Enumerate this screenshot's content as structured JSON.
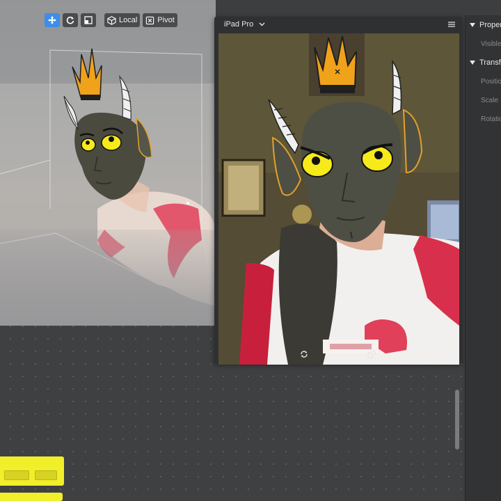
{
  "toolbar": {
    "move_tool": "move-arrows-icon",
    "rotate_tool": "rotate-icon",
    "scale_tool": "scale-icon",
    "space_label": "Local",
    "pivot_label": "Pivot"
  },
  "preview": {
    "device_label": "iPad Pro",
    "menu_icon": "hamburger-icon",
    "footer_left_icon": "flip-camera-icon",
    "footer_right_icon": "rotate-device-icon"
  },
  "inspector": {
    "section1_label": "Properties",
    "visible_label": "Visible",
    "section2_label": "Transform",
    "position_label": "Position",
    "scale_label": "Scale",
    "rotation_label": "Rotation"
  },
  "colors": {
    "accent": "#3c8ee8",
    "node_yellow": "#f1ee2a",
    "panel": "#2f3032"
  }
}
